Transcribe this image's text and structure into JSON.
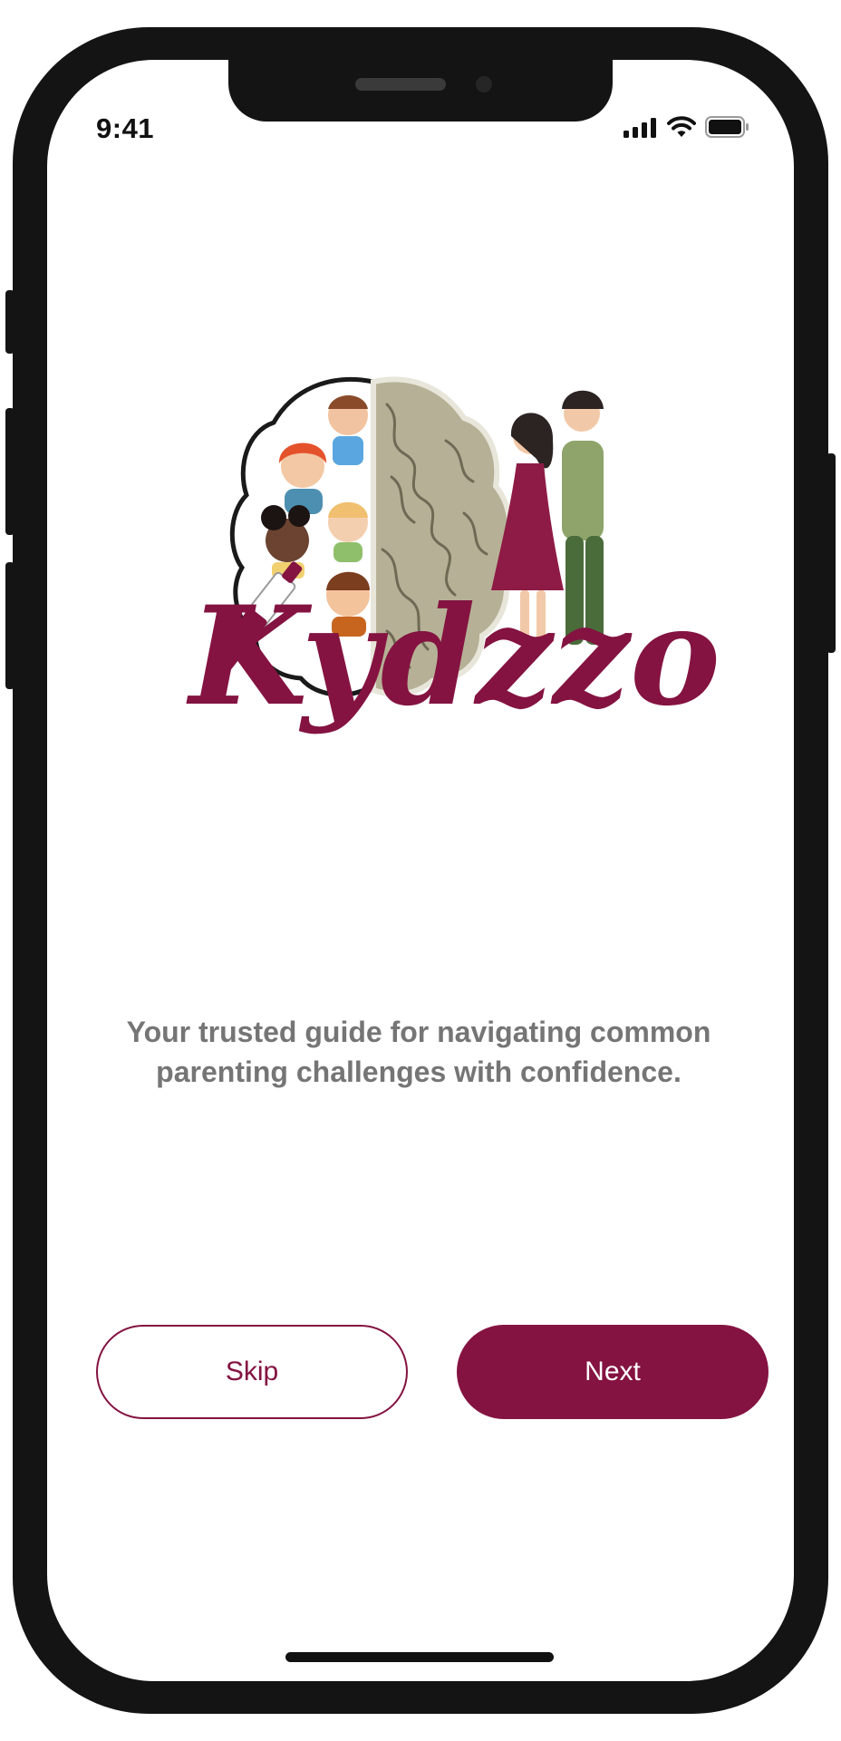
{
  "status_bar": {
    "time": "9:41",
    "icons": [
      "signal-icon",
      "wifi-icon",
      "battery-icon"
    ]
  },
  "brand": {
    "logo_text": "Kydzzo",
    "accent_color": "#841341"
  },
  "onboarding": {
    "tagline": "Your trusted guide for navigating common parenting challenges with confidence."
  },
  "actions": {
    "skip_label": "Skip",
    "next_label": "Next"
  }
}
